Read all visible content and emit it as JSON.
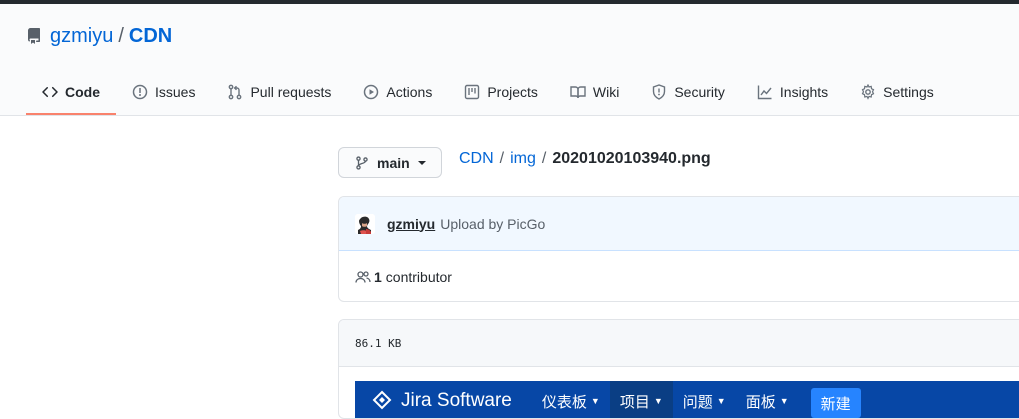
{
  "repo": {
    "owner": "gzmiyu",
    "separator": "/",
    "name": "CDN"
  },
  "tabs": [
    {
      "label": "Code",
      "icon": "code-icon",
      "selected": true
    },
    {
      "label": "Issues",
      "icon": "issue-icon"
    },
    {
      "label": "Pull requests",
      "icon": "pull-request-icon"
    },
    {
      "label": "Actions",
      "icon": "play-icon"
    },
    {
      "label": "Projects",
      "icon": "project-icon"
    },
    {
      "label": "Wiki",
      "icon": "book-icon"
    },
    {
      "label": "Security",
      "icon": "shield-icon"
    },
    {
      "label": "Insights",
      "icon": "graph-icon"
    },
    {
      "label": "Settings",
      "icon": "gear-icon"
    }
  ],
  "branch": {
    "label": "main"
  },
  "breadcrumb": {
    "root": "CDN",
    "sep1": "/",
    "folder": "img",
    "sep2": "/",
    "file": "20201020103940.png"
  },
  "commit": {
    "author": "gzmiyu",
    "message": "Upload by PicGo"
  },
  "contributors": {
    "count": "1",
    "label": "contributor"
  },
  "file": {
    "size": "86.1 KB"
  },
  "preview": {
    "title": "Jira Software",
    "items": [
      "仪表板",
      "项目",
      "问题",
      "面板"
    ],
    "create": "新建"
  },
  "colors": {
    "link": "#0366d6",
    "tab_underline": "#f9826c",
    "jira_blue": "#0747a6"
  }
}
